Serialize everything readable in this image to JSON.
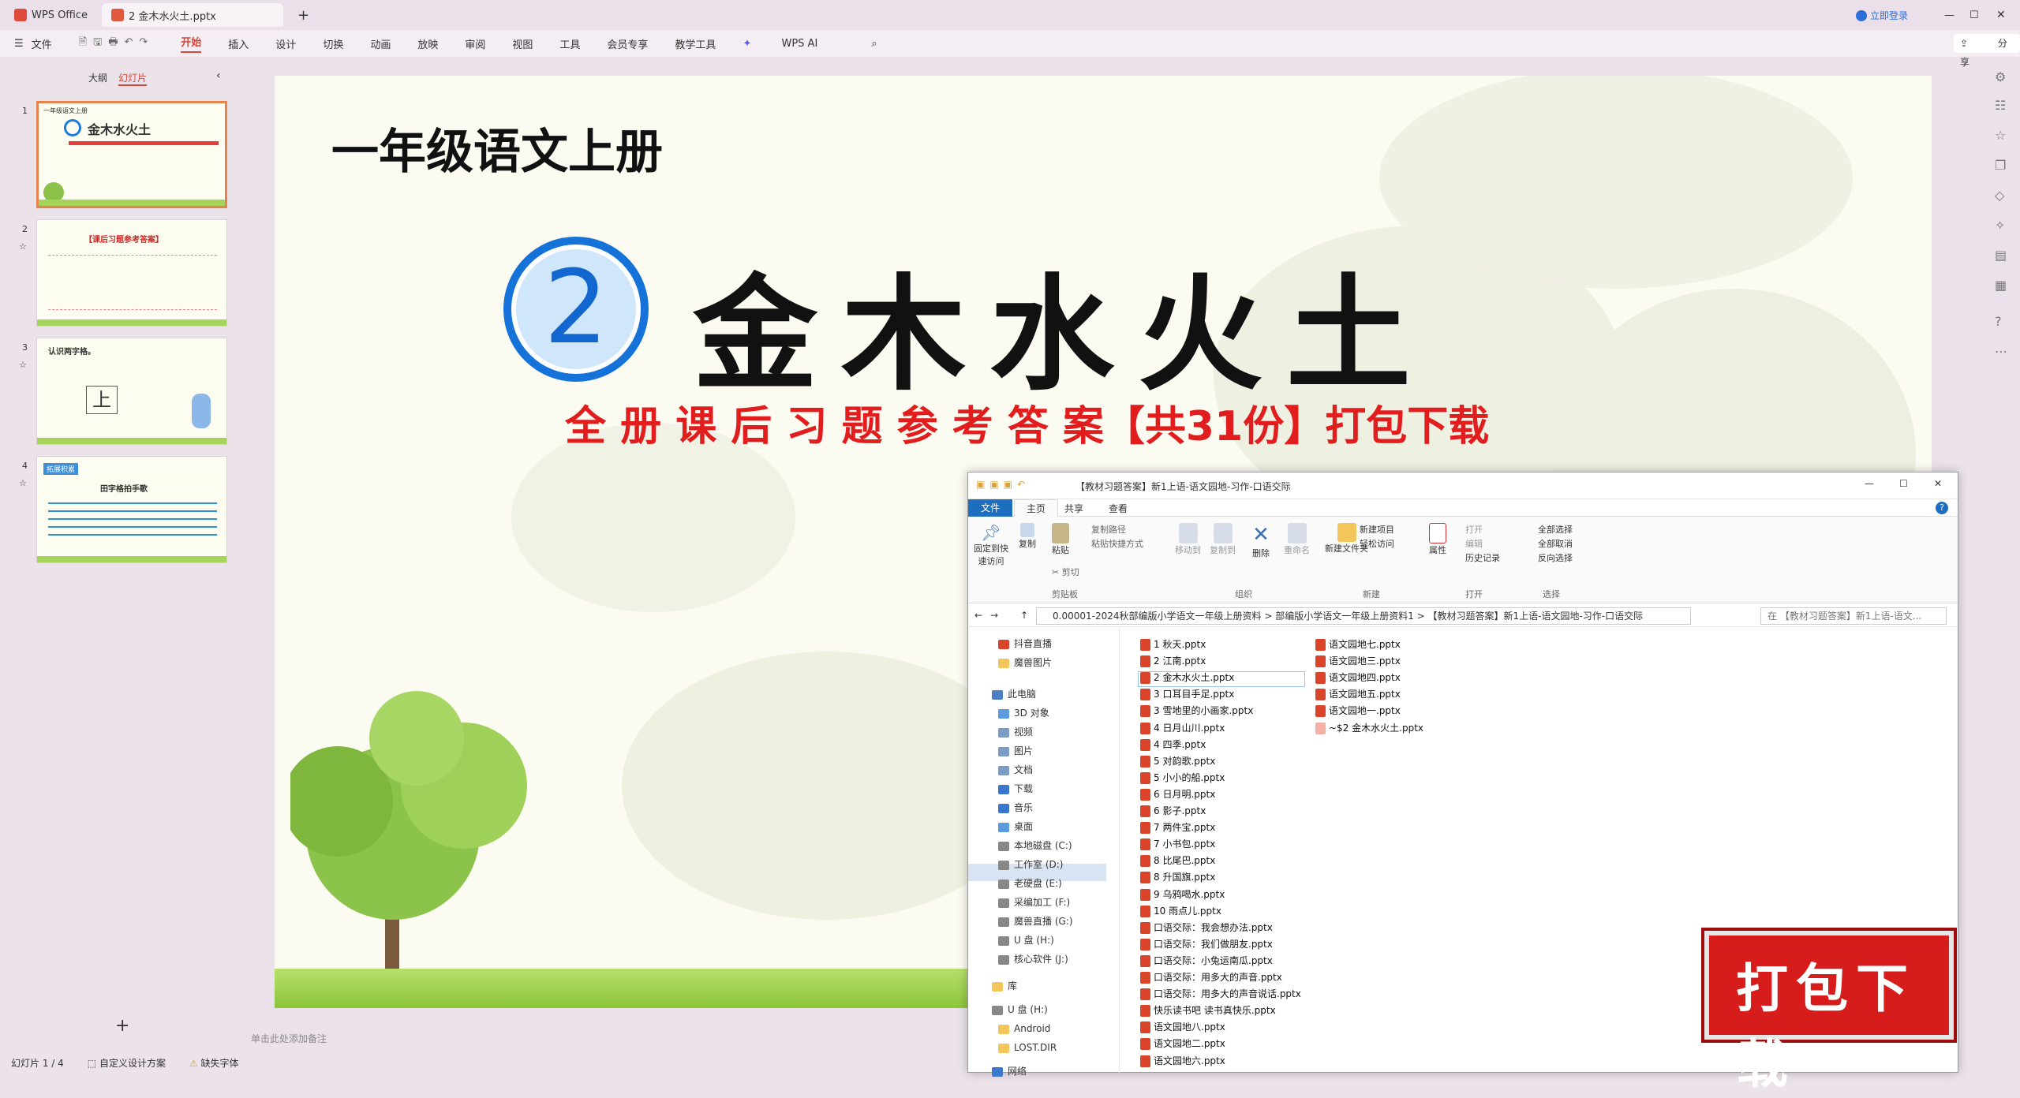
{
  "tabs": {
    "home": "WPS Office",
    "doc": "2 金木水火土.pptx",
    "login": "立即登录"
  },
  "ribbon": {
    "file": "文件",
    "items": [
      "开始",
      "插入",
      "设计",
      "切换",
      "动画",
      "放映",
      "审阅",
      "视图",
      "工具",
      "会员专享",
      "教学工具"
    ],
    "ai": "WPS AI",
    "share": "分享"
  },
  "panel": {
    "outline": "大纲",
    "slides": "幻灯片",
    "add": "+"
  },
  "slide": {
    "grade": "一年级语文上册",
    "num": "2",
    "title": "金木水火土",
    "subtitle": "全 册 课 后 习 题 参 考 答 案【共31份】打包下载"
  },
  "thumbs": [
    {
      "n": "1",
      "head": "一年级语文上册",
      "title": "金木水火土"
    },
    {
      "n": "2",
      "head": "【课后习题参考答案】"
    },
    {
      "n": "3",
      "head": "认识两字格。",
      "char": "上"
    },
    {
      "n": "4",
      "head": "拓展积累",
      "title": "田字格拍手歌"
    }
  ],
  "notes": "单击此处添加备注",
  "status": {
    "slide": "幻灯片 1 / 4",
    "design": "自定义设计方案",
    "font": "缺失字体"
  },
  "badge": "打包下载",
  "explorer": {
    "title": "【教材习题答案】新1上语-语文园地-习作-口语交际",
    "tabs": [
      "文件",
      "主页",
      "共享",
      "查看"
    ],
    "groups": [
      "剪贴板",
      "组织",
      "新建",
      "打开",
      "选择"
    ],
    "buttons": {
      "pin": "固定到快速访问",
      "copy": "复制",
      "paste": "粘贴",
      "copypath": "复制路径",
      "pasteshortcut": "粘贴快捷方式",
      "cut": "剪切",
      "moveto": "移动到",
      "copyto": "复制到",
      "delete": "删除",
      "rename": "重命名",
      "newfolder": "新建文件夹",
      "newitem": "新建项目",
      "easyaccess": "轻松访问",
      "props": "属性",
      "open": "打开",
      "edit": "编辑",
      "history": "历史记录",
      "selall": "全部选择",
      "selnone": "全部取消",
      "invert": "反向选择"
    },
    "path": [
      "0.00001-2024秋部编版小学语文一年级上册资料",
      "部编版小学语文一年级上册资料1",
      "【教材习题答案】新1上语-语文园地-习作-口语交际"
    ],
    "search": "在 【教材习题答案】新1上语-语文...",
    "nav": [
      "抖音直播",
      "魔兽图片",
      "此电脑",
      "3D 对象",
      "视频",
      "图片",
      "文档",
      "下载",
      "音乐",
      "桌面",
      "本地磁盘 (C:)",
      "工作室 (D:)",
      "老硬盘 (E:)",
      "采编加工 (F:)",
      "魔兽直播 (G:)",
      "U 盘 (H:)",
      "核心软件 (J:)",
      "库",
      "U 盘 (H:)",
      "Android",
      "LOST.DIR",
      "网络"
    ],
    "files1": [
      "1 秋天.pptx",
      "2 江南.pptx",
      "2 金木水火土.pptx",
      "3 口耳目手足.pptx",
      "3 雪地里的小画家.pptx",
      "4 日月山川.pptx",
      "4 四季.pptx",
      "5 对韵歌.pptx",
      "5 小小的船.pptx",
      "6 日月明.pptx",
      "6 影子.pptx",
      "7 两件宝.pptx",
      "7 小书包.pptx",
      "8 比尾巴.pptx",
      "8 升国旗.pptx",
      "9 乌鸦喝水.pptx",
      "10 雨点儿.pptx",
      "口语交际：我会想办法.pptx",
      "口语交际：我们做朋友.pptx",
      "口语交际：小兔运南瓜.pptx",
      "口语交际：用多大的声音.pptx",
      "口语交际：用多大的声音说话.pptx",
      "快乐读书吧 读书真快乐.pptx",
      "语文园地八.pptx",
      "语文园地二.pptx",
      "语文园地六.pptx"
    ],
    "files2": [
      "语文园地七.pptx",
      "语文园地三.pptx",
      "语文园地四.pptx",
      "语文园地五.pptx",
      "语文园地一.pptx",
      "~$2 金木水火土.pptx"
    ]
  }
}
